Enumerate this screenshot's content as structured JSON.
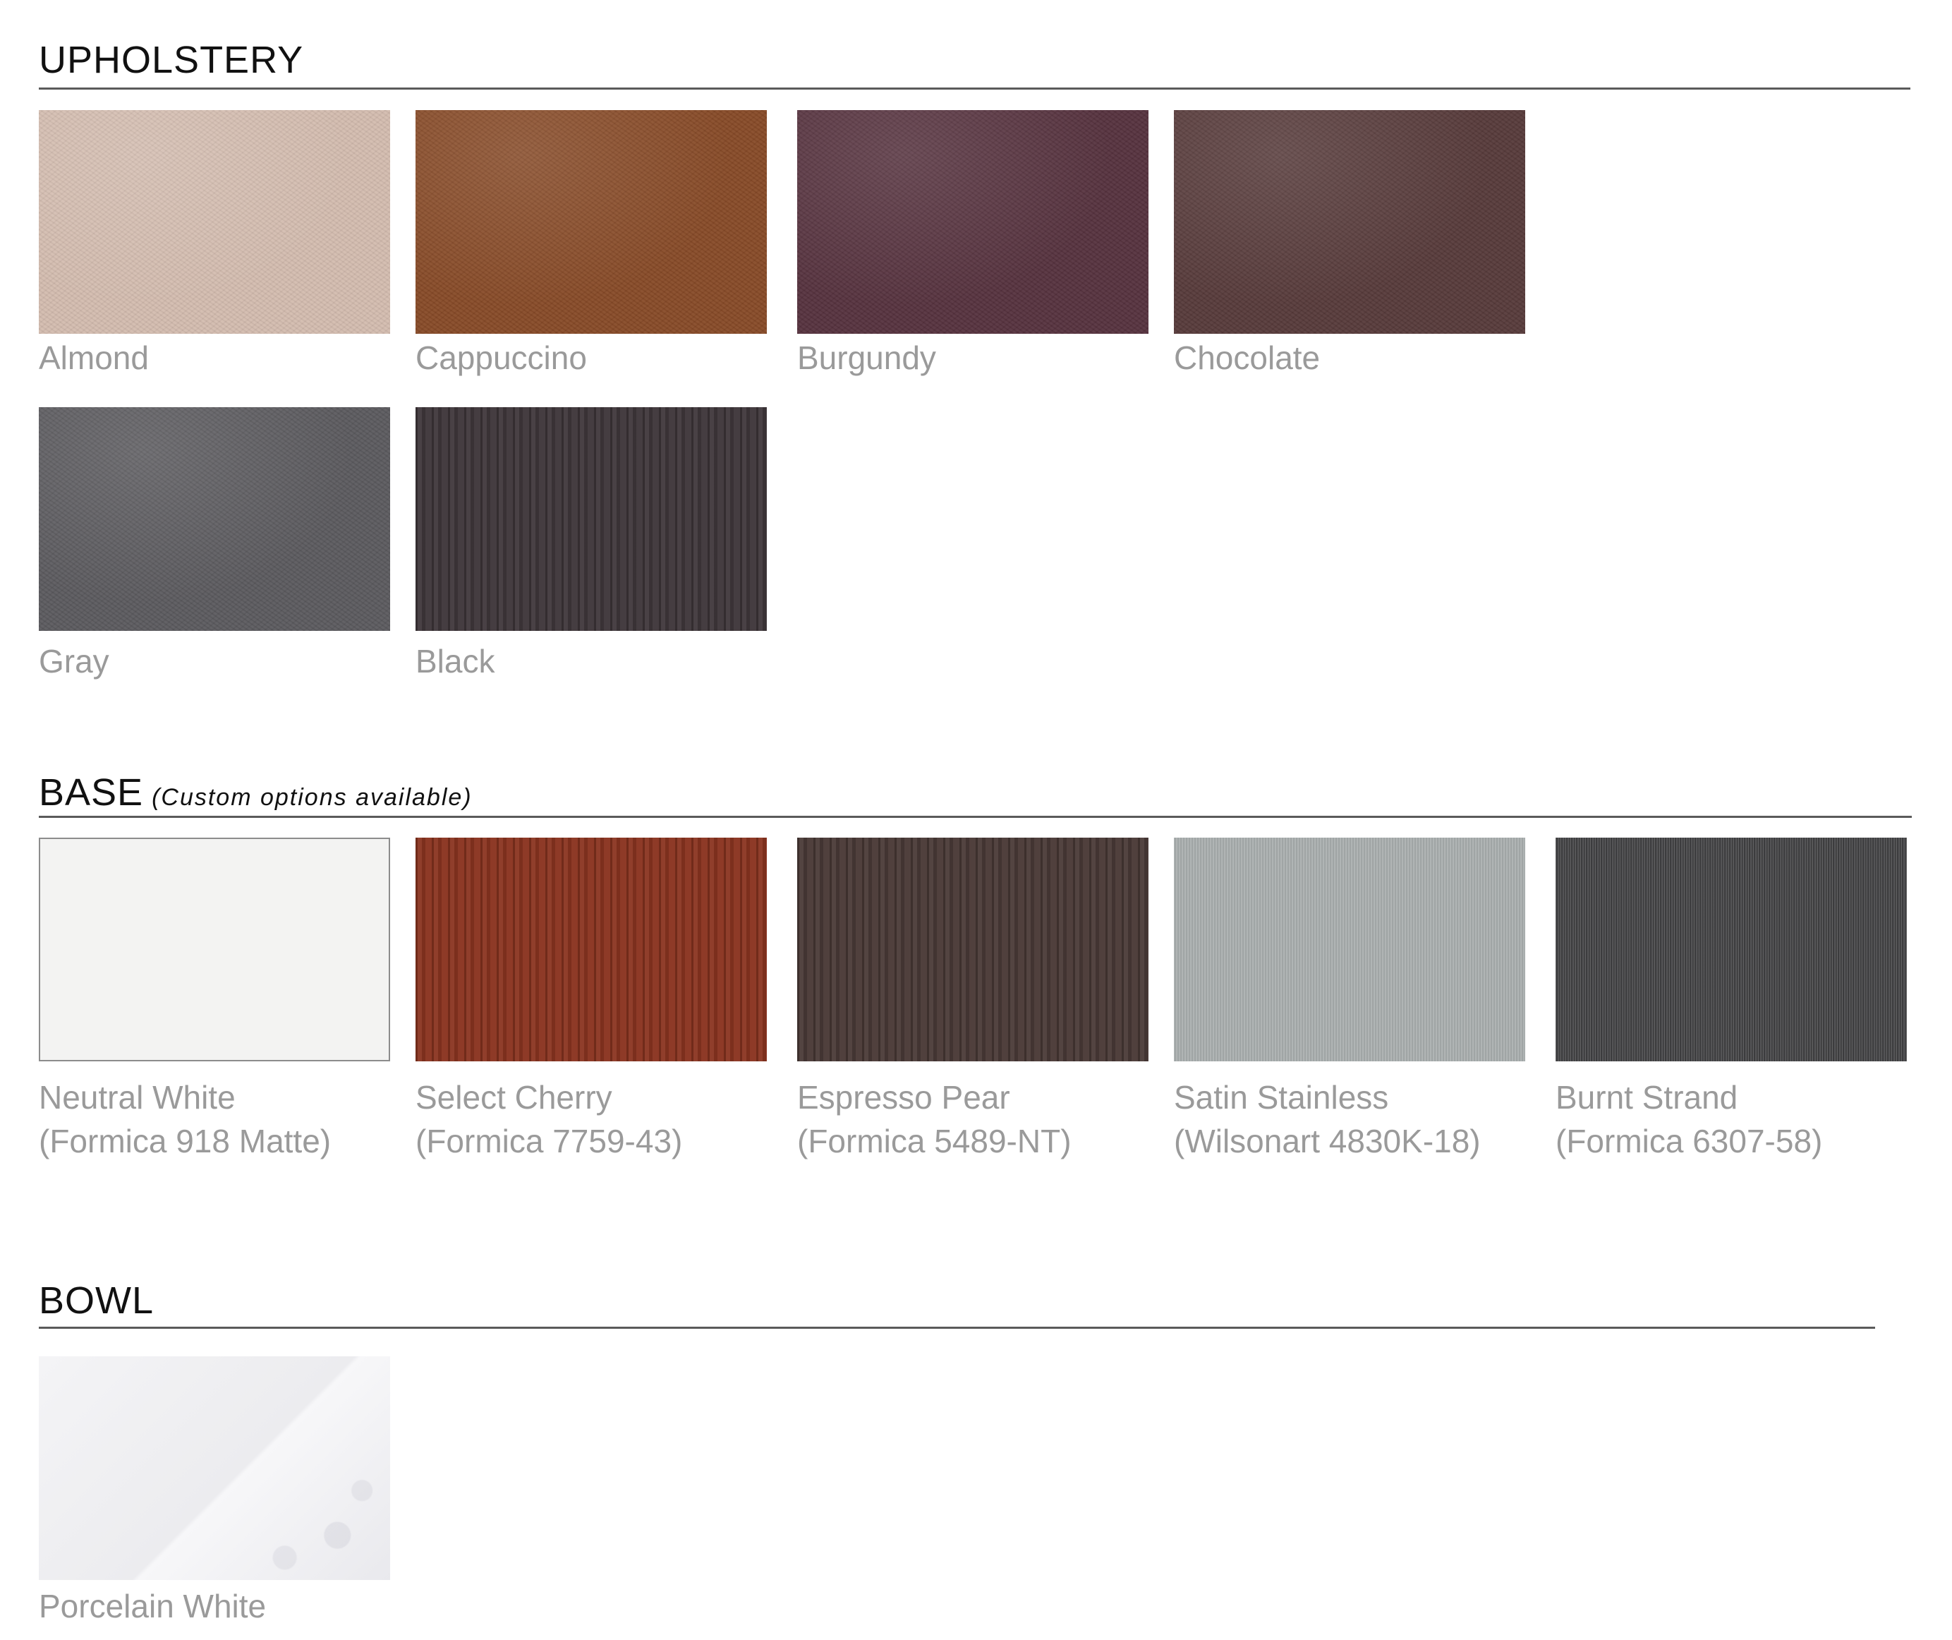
{
  "sections": {
    "upholstery": {
      "title": "UPHOLSTERY",
      "items": [
        {
          "name": "Almond",
          "color": "#d3bcaf"
        },
        {
          "name": "Cappuccino",
          "color": "#874a27"
        },
        {
          "name": "Burgundy",
          "color": "#56323e"
        },
        {
          "name": "Chocolate",
          "color": "#573a3a"
        },
        {
          "name": "Gray",
          "color": "#5b5a5e"
        },
        {
          "name": "Black",
          "color": "#3f373b"
        }
      ]
    },
    "base": {
      "title": "BASE",
      "subtitle": "(Custom options available)",
      "items": [
        {
          "name": "Neutral White",
          "code": "(Formica 918 Matte)",
          "color": "#f3f3f2"
        },
        {
          "name": "Select Cherry",
          "code": "(Formica 7759-43)",
          "color": "#8a3420"
        },
        {
          "name": "Espresso Pear",
          "code": "(Formica 5489-NT)",
          "color": "#4a3a37"
        },
        {
          "name": "Satin Stainless",
          "code": "(Wilsonart 4830K-18)",
          "color": "#a9aeae"
        },
        {
          "name": "Burnt Strand",
          "code": "(Formica 6307-58)",
          "color": "#49494b"
        }
      ]
    },
    "bowl": {
      "title": "BOWL",
      "items": [
        {
          "name": "Porcelain White",
          "color": "#efeff1"
        }
      ]
    }
  }
}
